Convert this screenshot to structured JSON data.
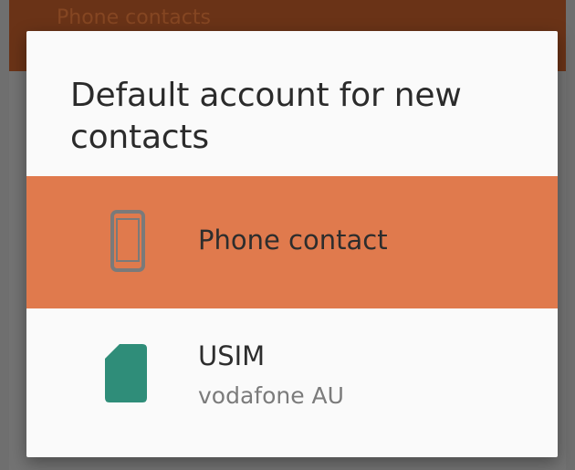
{
  "background": {
    "partial_text": "Phone contacts"
  },
  "dialog": {
    "title": "Default account for new contacts",
    "options": [
      {
        "label": "Phone contact",
        "icon": "smartphone-icon",
        "selected": true,
        "color": "#e07a4d"
      },
      {
        "label": "USIM",
        "subtitle": "vodafone AU",
        "icon": "sim-card-icon",
        "selected": false,
        "color": "#2f8d79"
      }
    ]
  },
  "colors": {
    "accent": "#e07a4d",
    "scrim": "#737373",
    "header": "#6a3317",
    "sim": "#2f8d79"
  }
}
